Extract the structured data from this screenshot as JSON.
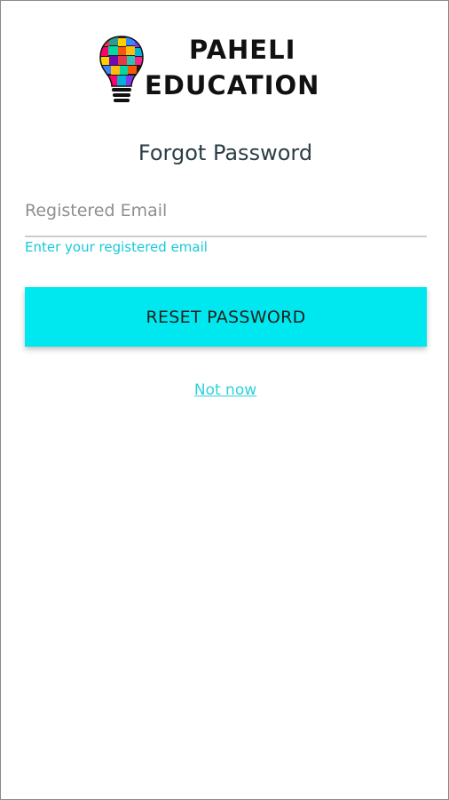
{
  "brand": {
    "line1": "PAHELI",
    "line2": "EDUCATION"
  },
  "screen": {
    "title": "Forgot Password"
  },
  "email_field": {
    "placeholder": "Registered Email",
    "value": "",
    "helper_text": "Enter your registered email"
  },
  "actions": {
    "reset_label": "RESET PASSWORD",
    "not_now_label": "Not now"
  },
  "colors": {
    "accent": "#00e8ef",
    "link": "#2fd0dc",
    "helper": "#17c9d8",
    "title": "#2c3e46"
  }
}
